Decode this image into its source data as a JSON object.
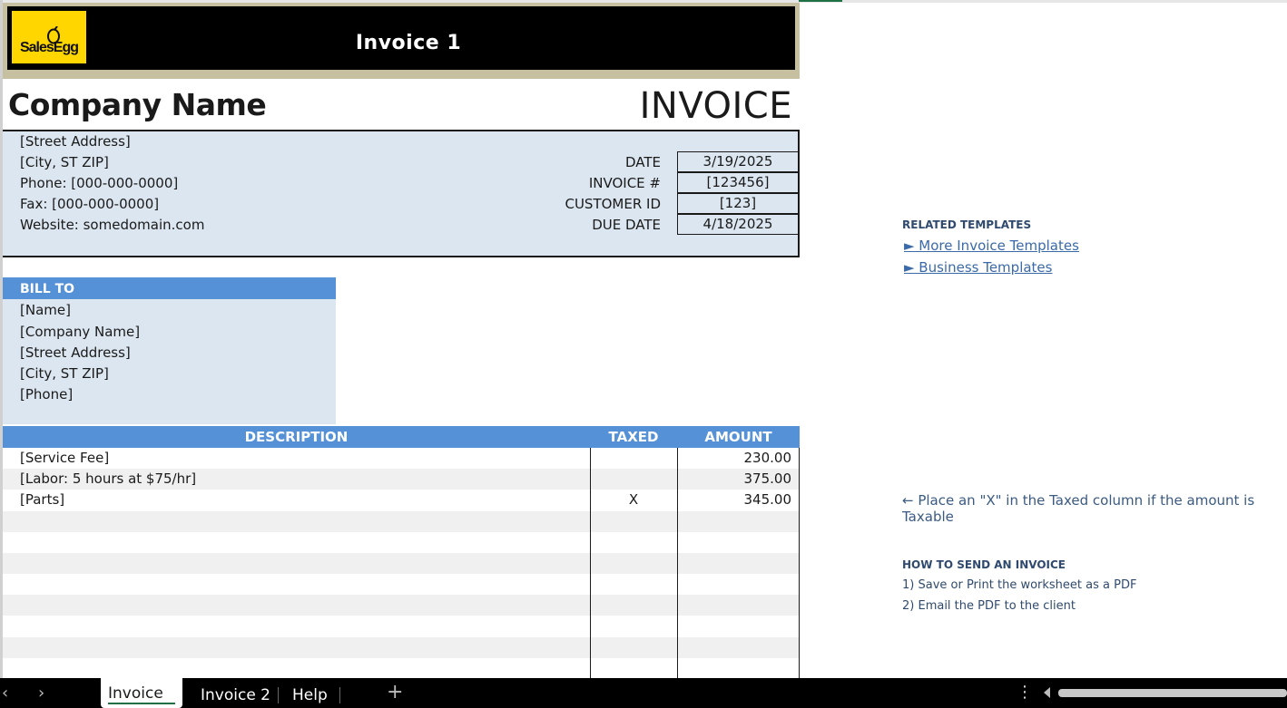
{
  "banner": {
    "title": "Invoice 1",
    "logo_text": "SalesEgg"
  },
  "heading": {
    "company": "Company Name",
    "doc_type": "INVOICE"
  },
  "address": {
    "lines": [
      "[Street Address]",
      "[City, ST  ZIP]",
      "Phone: [000-000-0000]",
      "Fax: [000-000-0000]",
      "Website: somedomain.com"
    ]
  },
  "meta": [
    {
      "label": "DATE",
      "value": "3/19/2025"
    },
    {
      "label": "INVOICE #",
      "value": "[123456]"
    },
    {
      "label": "CUSTOMER ID",
      "value": "[123]"
    },
    {
      "label": "DUE DATE",
      "value": "4/18/2025"
    }
  ],
  "bill_to": {
    "header": "BILL TO",
    "lines": [
      "[Name]",
      "[Company Name]",
      "[Street Address]",
      "[City, ST  ZIP]",
      "[Phone]"
    ]
  },
  "table": {
    "headers": {
      "description": "DESCRIPTION",
      "taxed": "TAXED",
      "amount": "AMOUNT"
    },
    "rows": [
      {
        "description": "[Service Fee]",
        "taxed": "",
        "amount": "230.00"
      },
      {
        "description": "[Labor: 5 hours at $75/hr]",
        "taxed": "",
        "amount": "375.00"
      },
      {
        "description": "[Parts]",
        "taxed": "X",
        "amount": "345.00"
      },
      {
        "description": "",
        "taxed": "",
        "amount": ""
      },
      {
        "description": "",
        "taxed": "",
        "amount": ""
      },
      {
        "description": "",
        "taxed": "",
        "amount": ""
      },
      {
        "description": "",
        "taxed": "",
        "amount": ""
      },
      {
        "description": "",
        "taxed": "",
        "amount": ""
      },
      {
        "description": "",
        "taxed": "",
        "amount": ""
      },
      {
        "description": "",
        "taxed": "",
        "amount": ""
      },
      {
        "description": "",
        "taxed": "",
        "amount": ""
      }
    ]
  },
  "side": {
    "related_header": "RELATED TEMPLATES",
    "link1": "► More Invoice Templates",
    "link2": "► Business Templates",
    "taxed_note": "← Place an \"X\" in the Taxed column if the amount is Taxable",
    "howto_header": "HOW TO SEND AN INVOICE",
    "step1": "1) Save or Print the worksheet as a PDF",
    "step2": "2) Email the PDF to the client"
  },
  "tabs": {
    "prev": "‹",
    "next": "›",
    "tab1": "Invoice 1",
    "tab2": "Invoice 2",
    "tab3": "Help",
    "add": "+",
    "more": "⋮"
  },
  "colors": {
    "accent_blue": "#5591d6",
    "light_blue": "#dce6f0",
    "logo_yellow": "#ffd600",
    "active_tab_underline": "#1e7145"
  }
}
